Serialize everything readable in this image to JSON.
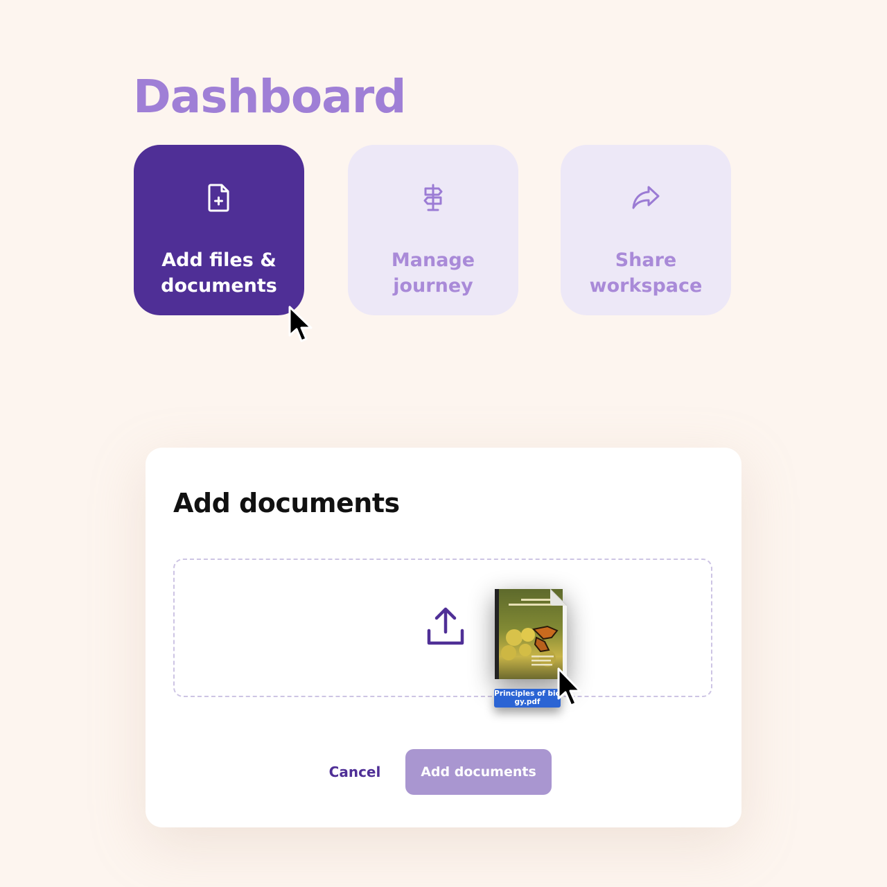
{
  "page": {
    "title": "Dashboard"
  },
  "cards": [
    {
      "label": "Add files &\ndocuments",
      "icon": "file-plus-icon",
      "state": "active"
    },
    {
      "label": "Manage\njourney",
      "icon": "signpost-icon",
      "state": "default"
    },
    {
      "label": "Share\nworkspace",
      "icon": "share-arrow-icon",
      "state": "default"
    }
  ],
  "dialog": {
    "title": "Add documents",
    "upload_icon": "upload-icon",
    "dragged_file": {
      "file_name": "Principles of bio\ngy.pdf",
      "icon": "pdf-document-icon"
    },
    "cancel_label": "Cancel",
    "submit_label": "Add documents"
  },
  "colors": {
    "background": "#fdf5ef",
    "brand": "#4f2f96",
    "title": "#9f7fd6",
    "card_inactive": "#ede8f7",
    "card_inactive_text": "#a98ad8",
    "button_disabled": "#a996d0",
    "file_tag": "#2b64d4"
  }
}
